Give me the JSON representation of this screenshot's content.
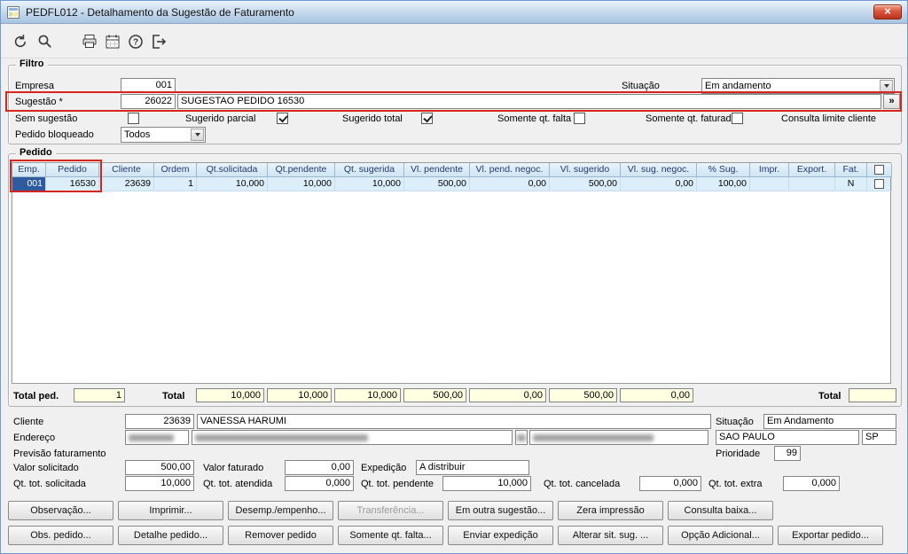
{
  "window": {
    "title": "PEDFL012 - Detalhamento da Sugestão de Faturamento",
    "close": "×"
  },
  "colors": {
    "annotation": "#d8251c",
    "selection": "#2e5a9e",
    "header_text": "#1e3a6e",
    "row_bg": "#ddeefb",
    "field_yellow": "#ffffe1"
  },
  "toolbar": {
    "icons": [
      "undo-icon",
      "search-icon",
      "print-icon",
      "calendar-icon",
      "help-icon",
      "exit-icon"
    ]
  },
  "filtro": {
    "title": "Filtro",
    "empresa": {
      "label": "Empresa",
      "value": "001"
    },
    "situacao": {
      "label": "Situação",
      "value": "Em andamento"
    },
    "sugestao": {
      "label": "Sugestão *",
      "code": "26022",
      "descricao": "SUGESTAO PEDIDO 16530",
      "zoom_button": "»"
    },
    "checkboxes": [
      {
        "label": "Sem sugestão",
        "checked": false
      },
      {
        "label": "Sugerido parcial",
        "checked": true
      },
      {
        "label": "Sugerido total",
        "checked": true
      },
      {
        "label": "Somente qt. falta",
        "checked": false
      },
      {
        "label": "Somente qt. faturada",
        "checked": false
      },
      {
        "label": "Consulta limite cliente",
        "checked": null
      }
    ],
    "pedido_bloqueado": {
      "label": "Pedido bloqueado",
      "value": "Todos"
    }
  },
  "pedido": {
    "title": "Pedido",
    "columns": [
      "Emp.",
      "Pedido",
      "Cliente",
      "Ordem",
      "Qt.solicitada",
      "Qt.pendente",
      "Qt. sugerida",
      "Vl. pendente",
      "Vl. pend. negoc.",
      "Vl. sugerido",
      "Vl. sug. negoc.",
      "% Sug.",
      "Impr.",
      "Export.",
      "Fat.",
      ""
    ],
    "rows": [
      [
        "001",
        "16530",
        "23639",
        "1",
        "10,000",
        "10,000",
        "10,000",
        "500,00",
        "0,00",
        "500,00",
        "0,00",
        "100,00",
        "",
        "",
        "N",
        ""
      ]
    ],
    "totais": {
      "total_ped_label": "Total ped.",
      "total_ped": "1",
      "total_label": "Total",
      "values": [
        "10,000",
        "10,000",
        "10,000",
        "500,00",
        "0,00",
        "500,00",
        "0,00"
      ],
      "total_right_label": "Total",
      "total_right": ""
    }
  },
  "detalhe": {
    "cliente": {
      "label": "Cliente",
      "codigo": "23639",
      "nome": "VANESSA HARUMI"
    },
    "situacao": {
      "label": "Situação",
      "value": "Em Andamento"
    },
    "endereco": {
      "label": "Endereço",
      "cidade": "SAO PAULO",
      "uf": "SP"
    },
    "previsao": {
      "label": "Previsão faturamento"
    },
    "prioridade": {
      "label": "Prioridade",
      "value": "99"
    },
    "valor_solicitado": {
      "label": "Valor solicitado",
      "value": "500,00"
    },
    "valor_faturado": {
      "label": "Valor faturado",
      "value": "0,00"
    },
    "expedicao": {
      "label": "Expedição",
      "value": "A distribuir"
    },
    "qt_tot_solicitada": {
      "label": "Qt. tot. solicitada",
      "value": "10,000"
    },
    "qt_tot_atendida": {
      "label": "Qt. tot. atendida",
      "value": "0,000"
    },
    "qt_tot_pendente": {
      "label": "Qt. tot. pendente",
      "value": "10,000"
    },
    "qt_tot_cancelada": {
      "label": "Qt. tot. cancelada",
      "value": "0,000"
    },
    "qt_tot_extra": {
      "label": "Qt. tot. extra",
      "value": "0,000"
    }
  },
  "botoes": {
    "linha1": [
      {
        "label": "Observação...",
        "enabled": true
      },
      {
        "label": "Imprimir...",
        "enabled": true
      },
      {
        "label": "Desemp./empenho...",
        "enabled": true
      },
      {
        "label": "Transferência...",
        "enabled": false
      },
      {
        "label": "Em outra sugestão...",
        "enabled": true
      },
      {
        "label": "Zera impressão",
        "enabled": true
      },
      {
        "label": "Consulta baixa...",
        "enabled": true
      }
    ],
    "linha2": [
      {
        "label": "Obs. pedido...",
        "enabled": true
      },
      {
        "label": "Detalhe pedido...",
        "enabled": true
      },
      {
        "label": "Remover pedido",
        "enabled": true
      },
      {
        "label": "Somente qt. falta...",
        "enabled": true
      },
      {
        "label": "Enviar expedição",
        "enabled": true
      },
      {
        "label": "Alterar sit. sug. ...",
        "enabled": true
      },
      {
        "label": "Opção Adicional...",
        "enabled": true
      },
      {
        "label": "Exportar pedido...",
        "enabled": true
      }
    ]
  }
}
